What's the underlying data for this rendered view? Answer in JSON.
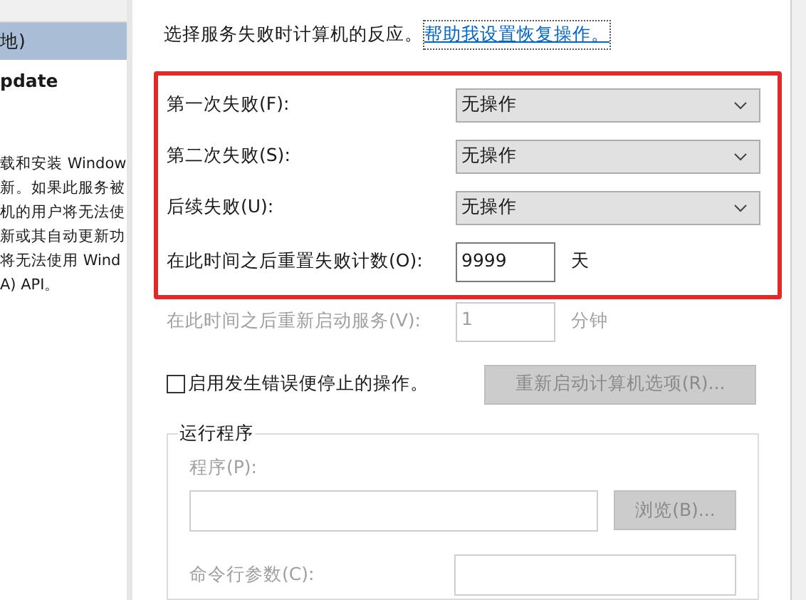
{
  "left_panel": {
    "selected_item": {
      "label": "地)",
      "selected": true
    },
    "title": "pdate",
    "description_lines": [
      "载和安装 Window",
      "新。如果此服务被",
      "机的用户将无法使",
      "新或其自动更新功",
      "将无法使用 Wind",
      "A) API。"
    ]
  },
  "intro": {
    "text": "选择服务失败时计算机的反应。",
    "link": "帮助我设置恢复操作。"
  },
  "failure_rows": [
    {
      "label": "第一次失败(F):",
      "value": "无操作"
    },
    {
      "label": "第二次失败(S):",
      "value": "无操作"
    },
    {
      "label": "后续失败(U):",
      "value": "无操作"
    }
  ],
  "reset_row": {
    "label": "在此时间之后重置失败计数(O):",
    "value": "9999",
    "unit": "天",
    "highlighted": true
  },
  "restart_row": {
    "label": "在此时间之后重新启动服务(V):",
    "value": "1",
    "unit": "分钟",
    "disabled": true
  },
  "stop_on_error": {
    "label": "启用发生错误便停止的操作。",
    "checked": false
  },
  "restart_computer_button": {
    "label": "重新启动计算机选项(R)...",
    "disabled": true
  },
  "run_program": {
    "title": "运行程序",
    "disabled": true,
    "program_label": "程序(P):",
    "browse_button": "浏览(B)...",
    "args_label": "命令行参数(C):"
  }
}
